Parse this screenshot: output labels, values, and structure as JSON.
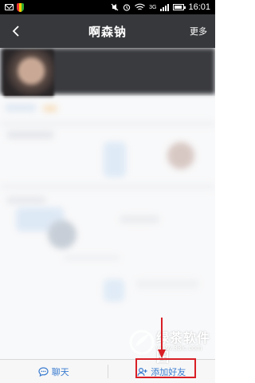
{
  "status_bar": {
    "network": "3G",
    "time": "16:01"
  },
  "header": {
    "title": "啊森钠",
    "more_label": "更多",
    "back_icon": "chevron-left-icon"
  },
  "bottom_bar": {
    "chat_label": "聊天",
    "chat_icon": "chat-bubble-icon",
    "add_friend_label": "添加好友",
    "add_friend_icon": "add-person-icon"
  },
  "annotation": {
    "highlight_color": "#d81f26"
  },
  "watermark": {
    "text": "绿茶软件园",
    "url": "www.33lc.com"
  },
  "colors": {
    "title_bar": "#37383b",
    "accent": "#3a7cd0"
  }
}
